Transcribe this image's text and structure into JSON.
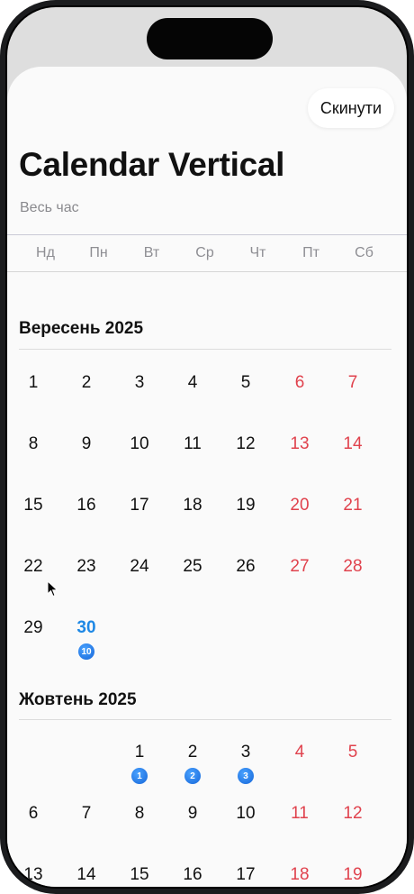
{
  "header": {
    "reset_label": "Скинути",
    "title": "Calendar Vertical",
    "subtitle": "Весь час"
  },
  "weekdays": [
    "Нд",
    "Пн",
    "Вт",
    "Ср",
    "Чт",
    "Пт",
    "Сб"
  ],
  "months": [
    {
      "title": "Вересень 2025",
      "weeks": [
        [
          "1",
          "2",
          "3",
          "4",
          "5",
          "6",
          "7"
        ],
        [
          "8",
          "9",
          "10",
          "11",
          "12",
          "13",
          "14"
        ],
        [
          "15",
          "16",
          "17",
          "18",
          "19",
          "20",
          "21"
        ],
        [
          "22",
          "23",
          "24",
          "25",
          "26",
          "27",
          "28"
        ],
        [
          "29",
          "30",
          "",
          "",
          "",
          "",
          ""
        ]
      ],
      "today": "30",
      "badges": {
        "30": "10"
      }
    },
    {
      "title": "Жовтень 2025",
      "weeks": [
        [
          "",
          "",
          "1",
          "2",
          "3",
          "4",
          "5"
        ],
        [
          "6",
          "7",
          "8",
          "9",
          "10",
          "11",
          "12"
        ],
        [
          "13",
          "14",
          "15",
          "16",
          "17",
          "18",
          "19"
        ]
      ],
      "today": "",
      "badges": {
        "1": "1",
        "2": "2",
        "3": "3"
      }
    }
  ],
  "colors": {
    "weekend": "#e0424d",
    "today": "#1e88e5",
    "badge": "#1e7ae8",
    "text": "#111111",
    "muted": "#8e8e93"
  }
}
